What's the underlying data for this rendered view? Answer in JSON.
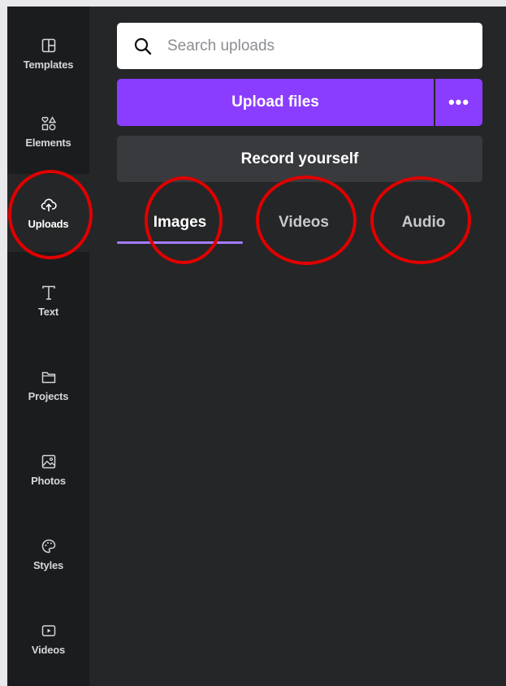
{
  "sidebar": {
    "items": [
      {
        "label": "Templates",
        "icon": "templates-icon",
        "active": false
      },
      {
        "label": "Elements",
        "icon": "elements-icon",
        "active": false
      },
      {
        "label": "Uploads",
        "icon": "upload-cloud-icon",
        "active": true
      },
      {
        "label": "Text",
        "icon": "text-icon",
        "active": false
      },
      {
        "label": "Projects",
        "icon": "folder-icon",
        "active": false
      },
      {
        "label": "Photos",
        "icon": "photo-icon",
        "active": false
      },
      {
        "label": "Styles",
        "icon": "palette-icon",
        "active": false
      },
      {
        "label": "Videos",
        "icon": "video-play-icon",
        "active": false
      }
    ]
  },
  "search": {
    "placeholder": "Search uploads",
    "icon": "search-icon"
  },
  "upload_button": {
    "label": "Upload files"
  },
  "more_button": {
    "label": "•••"
  },
  "record_button": {
    "label": "Record yourself"
  },
  "tabs": [
    {
      "label": "Images",
      "active": true
    },
    {
      "label": "Videos",
      "active": false
    },
    {
      "label": "Audio",
      "active": false
    }
  ],
  "colors": {
    "accent": "#8b3dff",
    "tab_underline": "#a57cff",
    "annotation": "#e00000",
    "panel_bg": "#252627",
    "sidebar_bg": "#1b1c1d"
  }
}
